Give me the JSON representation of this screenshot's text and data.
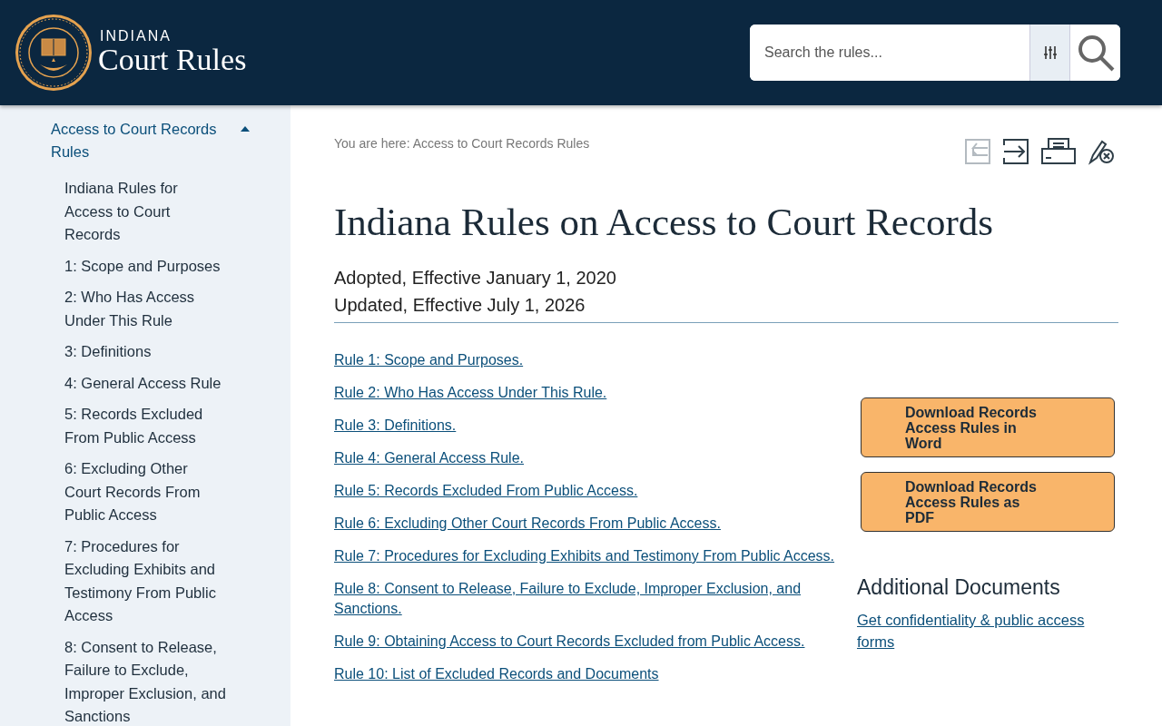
{
  "header": {
    "logo_small": "INDIANA",
    "logo_large": "Court Rules",
    "search": {
      "placeholder": "Search the rules..."
    }
  },
  "sidebar": {
    "section": {
      "label": "Access to Court Records Rules",
      "expanded": true
    },
    "items": [
      "Indiana Rules for Access to Court Records",
      "1: Scope and Purposes",
      "2: Who Has Access Under This Rule",
      "3: Definitions",
      "4: General Access Rule",
      "5: Records Excluded From Public Access",
      "6: Excluding Other Court Records From Public Access",
      "7: Procedures for Excluding Exhibits and Testimony From Public Access",
      "8: Consent to Release, Failure to Exclude, Improper Exclusion, and Sanctions"
    ]
  },
  "breadcrumb": "You are here: Access to Court Records Rules",
  "tools": [
    {
      "kind": "previous",
      "disabled": true
    },
    {
      "kind": "next",
      "disabled": false
    },
    {
      "kind": "print",
      "disabled": false
    },
    {
      "kind": "clear",
      "disabled": false
    }
  ],
  "title": "Indiana Rules on Access to Court Records",
  "dates": [
    "Adopted, Effective January 1, 2020",
    "Updated, Effective July 1, 2026"
  ],
  "rules": [
    "Rule 1: Scope and Purposes.",
    "Rule 2: Who Has Access Under This Rule.",
    "Rule 3: Definitions.",
    "Rule 4: General Access Rule.",
    "Rule 5: Records Excluded From Public Access.",
    "Rule 6: Excluding Other Court Records From Public Access.",
    "Rule 7: Procedures for Excluding Exhibits and Testimony From Public Access.",
    "Rule 8: Consent to Release, Failure to Exclude, Improper Exclusion, and Sanctions.",
    "Rule 9: Obtaining Access to Court Records Excluded from Public Access.",
    "Rule 10: List of Excluded Records and Documents"
  ],
  "downloads": [
    "Download Records Access Rules in Word",
    "Download Records Access Rules as PDF"
  ],
  "additional": {
    "heading": "Additional Documents",
    "link": "Get confidentiality & public access forms"
  }
}
